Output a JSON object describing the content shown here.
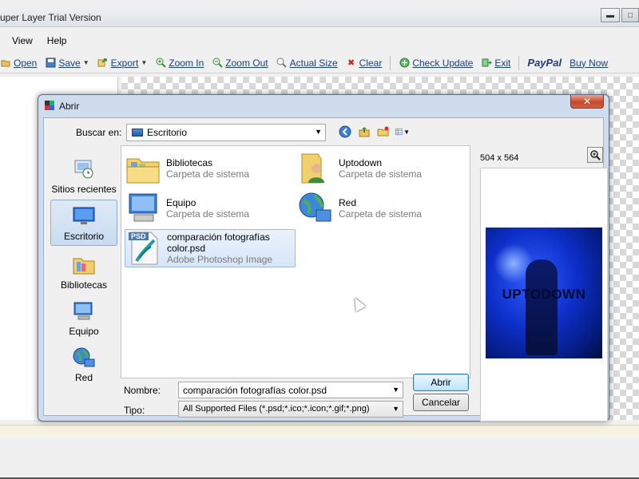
{
  "app": {
    "title": "uper Layer Trial Version",
    "window_buttons": {
      "minimize": "▬",
      "maximize": "□"
    },
    "menu": [
      "View",
      "Help"
    ],
    "toolbar": [
      {
        "icon": "open-icon",
        "label": "Open"
      },
      {
        "icon": "save-icon",
        "label": "Save",
        "dropdown": true
      },
      {
        "icon": "export-icon",
        "label": "Export",
        "dropdown": true
      },
      {
        "icon": "zoom-in-icon",
        "label": "Zoom In"
      },
      {
        "icon": "zoom-out-icon",
        "label": "Zoom Out"
      },
      {
        "icon": "actual-size-icon",
        "label": "Actual Size"
      },
      {
        "icon": "clear-icon",
        "label": "Clear"
      },
      {
        "icon": "check-update-icon",
        "label": "Check Update"
      },
      {
        "icon": "exit-icon",
        "label": "Exit"
      },
      {
        "icon": "paypal-logo",
        "label": "PayPal"
      },
      {
        "icon": "buy-now-icon",
        "label": "Buy Now"
      }
    ]
  },
  "dialog": {
    "title": "Abrir",
    "close_label": "✕",
    "look_in_label": "Buscar en:",
    "look_in_value": "Escritorio",
    "places": [
      {
        "label": "Sitios recientes",
        "icon": "recent-places-icon",
        "selected": false
      },
      {
        "label": "Escritorio",
        "icon": "desktop-icon",
        "selected": true
      },
      {
        "label": "Bibliotecas",
        "icon": "libraries-icon",
        "selected": false
      },
      {
        "label": "Equipo",
        "icon": "computer-icon",
        "selected": false
      },
      {
        "label": "Red",
        "icon": "network-icon",
        "selected": false
      }
    ],
    "files": [
      {
        "name": "Bibliotecas",
        "type": "Carpeta de sistema",
        "icon": "libraries-folder-icon"
      },
      {
        "name": "Uptodown",
        "type": "Carpeta de sistema",
        "icon": "user-folder-icon"
      },
      {
        "name": "Equipo",
        "type": "Carpeta de sistema",
        "icon": "computer-icon"
      },
      {
        "name": "Red",
        "type": "Carpeta de sistema",
        "icon": "network-icon"
      },
      {
        "name_line1": "comparación fotografías",
        "name_line2": "color.psd",
        "type": "Adobe Photoshop Image",
        "icon": "psd-file-icon",
        "badge": "PSD",
        "selected": true
      }
    ],
    "preview": {
      "size_text": "504 x 564",
      "watermark": "UPTODOWN"
    },
    "filename_label": "Nombre:",
    "filename_value": "comparación fotografías color.psd",
    "type_label": "Tipo:",
    "type_value": "All Supported Files (*.psd;*.ico;*.icon;*.gif;*.png)",
    "open_button": "Abrir",
    "cancel_button": "Cancelar"
  }
}
